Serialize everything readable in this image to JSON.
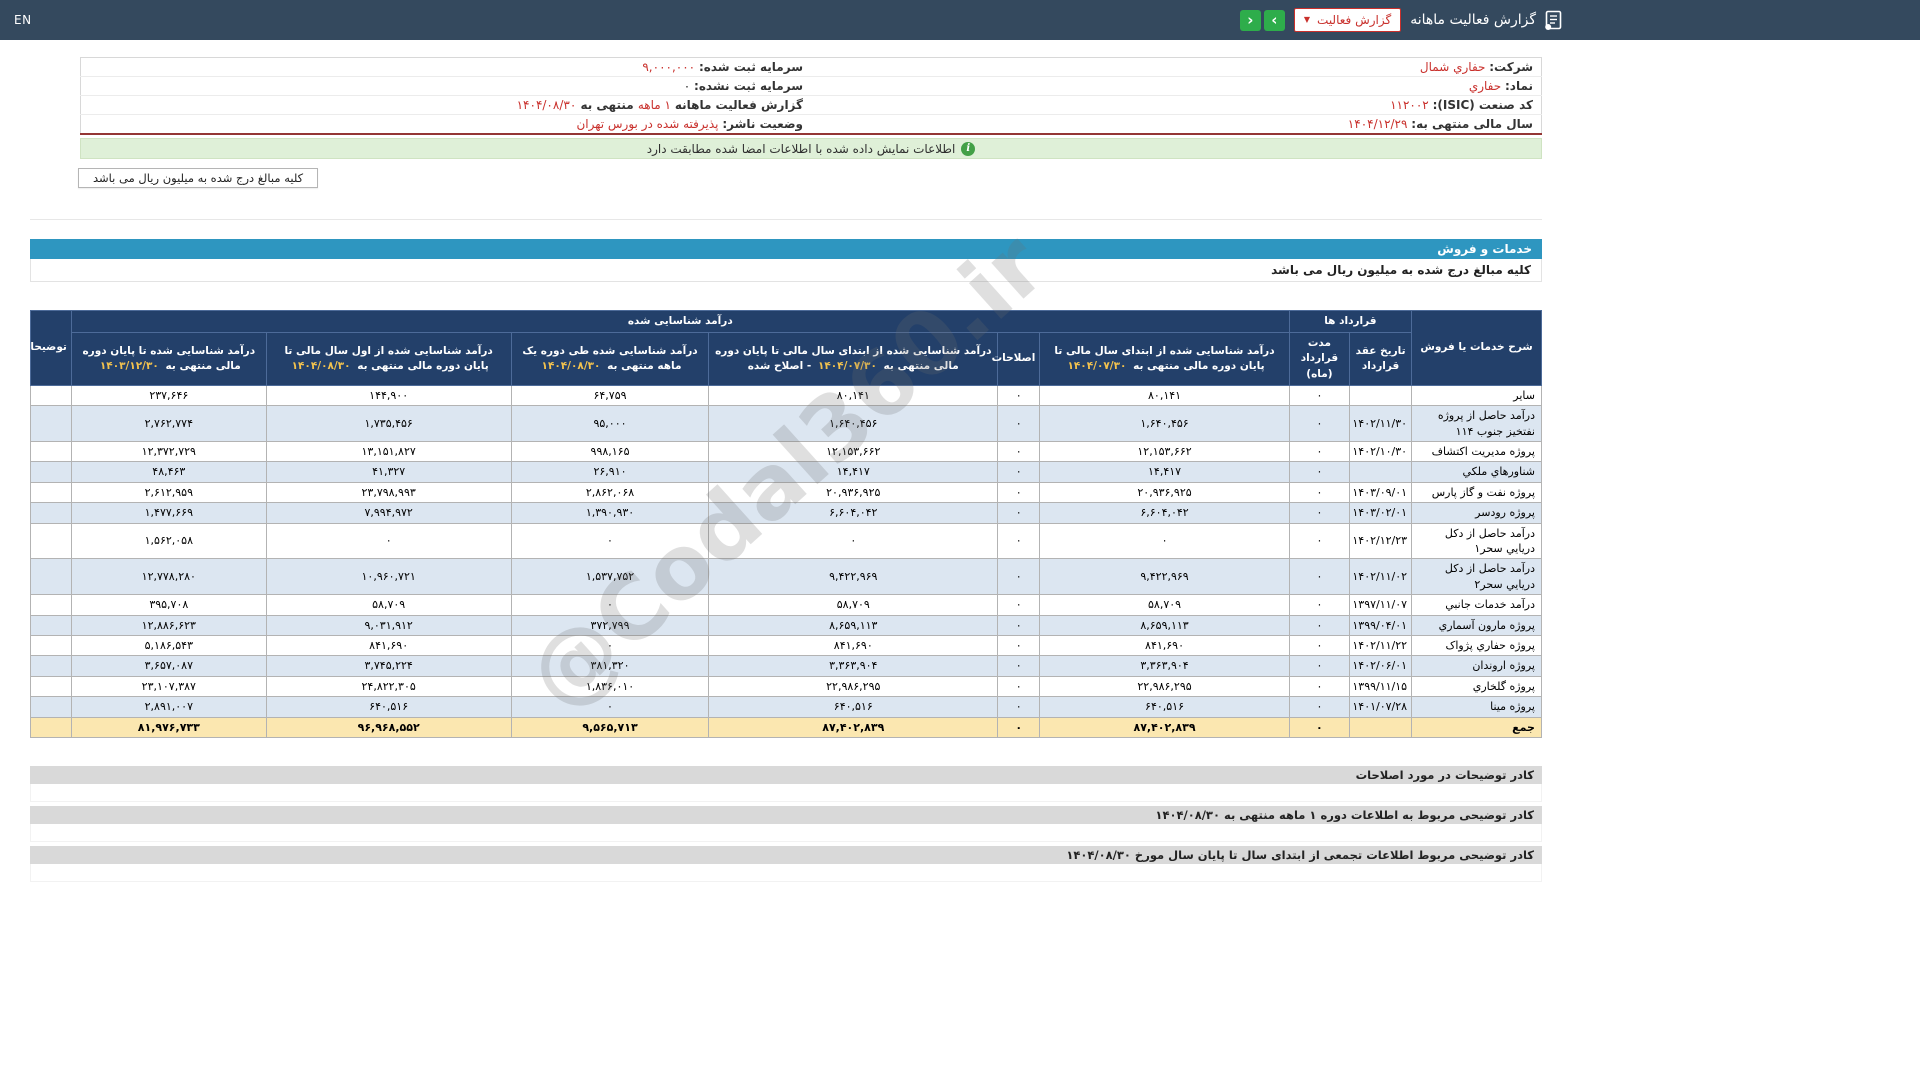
{
  "colors": {
    "topbar_bg": "#34495e",
    "accent_red": "#c9302c",
    "nav_green": "#2ead4b",
    "banner_green_bg": "#dff0d8",
    "rule_red": "#943634",
    "section_blue": "#2e96c0",
    "table_header_bg": "#23406a",
    "header_date_yellow": "#f2c24e",
    "row_stripe_blue": "#dce6f1",
    "total_row_bg": "#fbe7b0",
    "footer_gray": "#d9d9d9"
  },
  "topbar": {
    "title": "گزارش فعالیت ماهانه",
    "dropdown_label": "گزارش فعالیت",
    "dropdown_caret": "▼",
    "next_arrow": "›",
    "prev_arrow": "‹",
    "en_label": "EN"
  },
  "company_info": {
    "rows": [
      {
        "right": [
          {
            "t": "شرکت:",
            "k": "label"
          },
          {
            "t": " حفاري شمال",
            "k": "link"
          }
        ],
        "left": [
          {
            "t": "سرمایه ثبت شده:",
            "k": "label"
          },
          {
            "t": " ۹,۰۰۰,۰۰۰",
            "k": "red"
          }
        ]
      },
      {
        "right": [
          {
            "t": "نماد:",
            "k": "label"
          },
          {
            "t": " حفاري",
            "k": "red"
          }
        ],
        "left": [
          {
            "t": "سرمایه ثبت نشده:",
            "k": "label"
          },
          {
            "t": " ۰",
            "k": "plain"
          }
        ]
      },
      {
        "right": [
          {
            "t": "کد صنعت (ISIC):",
            "k": "label"
          },
          {
            "t": " ۱۱۲۰۰۲",
            "k": "red"
          }
        ],
        "left": [
          {
            "t": "گزارش فعالیت ماهانه",
            "k": "label"
          },
          {
            "t": " ۱ ماهه",
            "k": "red"
          },
          {
            "t": " منتهی به ",
            "k": "label"
          },
          {
            "t": "۱۴۰۴/۰۸/۳۰",
            "k": "red"
          }
        ]
      },
      {
        "right": [
          {
            "t": "سال مالی منتهی به:",
            "k": "label"
          },
          {
            "t": " ۱۴۰۴/۱۲/۲۹",
            "k": "red"
          }
        ],
        "left": [
          {
            "t": "وضعیت ناشر:",
            "k": "label"
          },
          {
            "t": " پذیرفته شده در بورس تهران",
            "k": "red"
          }
        ]
      }
    ]
  },
  "banners": {
    "signature_match": "اطلاعات نمایش داده شده با اطلاعات امضا شده مطابقت دارد",
    "million_note": "کلیه مبالغ درج شده به میلیون ریال می باشد"
  },
  "watermark": "@Codal360.ir",
  "sales_table": {
    "section_title": "خدمات و فروش",
    "note": "کلیه مبالغ درج شده به میلیون ریال می باشد",
    "header": {
      "desc": "شرح خدمات یا فروش",
      "contracts_group": "قرارداد ها",
      "revenue_group": "درآمد شناسایی شده",
      "notes": "توضیحات",
      "contract_date": "تاریخ عقد قرارداد",
      "contract_duration": "مدت قرارداد (ماه)",
      "col_prev_period": {
        "text": "درآمد شناسایی شده از ابتدای سال مالی تا پایان دوره مالی منتهی به",
        "date": "۱۴۰۴/۰۷/۳۰"
      },
      "col_corrections": "اصلاحات",
      "col_prev_corrected": {
        "text": "درآمد شناسایی شده از ابتدای سال مالی تا پایان دوره مالی منتهی به",
        "date": "۱۴۰۴/۰۷/۳۰",
        "suffix": "- اصلاح شده"
      },
      "col_month": {
        "text": "درآمد شناسایی شده طی دوره یک ماهه منتهی به",
        "date": "۱۴۰۴/۰۸/۳۰"
      },
      "col_ytd": {
        "text": "درآمد شناسایی شده از اول سال مالی تا پایان دوره مالی منتهی به",
        "date": "۱۴۰۴/۰۸/۳۰"
      },
      "col_prev_year": {
        "text": "درآمد شناسایی شده تا پایان دوره مالی منتهی به",
        "date": "۱۴۰۳/۱۲/۳۰"
      }
    },
    "rows": [
      [
        "سایر",
        "",
        "۰",
        "۸۰,۱۴۱",
        "۰",
        "۸۰,۱۴۱",
        "۶۴,۷۵۹",
        "۱۴۴,۹۰۰",
        "۲۳۷,۶۴۶",
        ""
      ],
      [
        "درآمد حاصل از پروژه نفتخیز جنوب ۱۱۴",
        "۱۴۰۲/۱۱/۳۰",
        "۰",
        "۱,۶۴۰,۴۵۶",
        "۰",
        "۱,۶۴۰,۴۵۶",
        "۹۵,۰۰۰",
        "۱,۷۳۵,۴۵۶",
        "۲,۷۶۲,۷۷۴",
        ""
      ],
      [
        "پروژه مدیریت اکتشاف",
        "۱۴۰۲/۱۰/۳۰",
        "۰",
        "۱۲,۱۵۳,۶۶۲",
        "۰",
        "۱۲,۱۵۳,۶۶۲",
        "۹۹۸,۱۶۵",
        "۱۳,۱۵۱,۸۲۷",
        "۱۲,۳۷۲,۷۲۹",
        ""
      ],
      [
        "شناورهاي ملكي",
        "",
        "۰",
        "۱۴,۴۱۷",
        "۰",
        "۱۴,۴۱۷",
        "۲۶,۹۱۰",
        "۴۱,۳۲۷",
        "۴۸,۴۶۳",
        ""
      ],
      [
        "پروژه نفت و گاز پارس",
        "۱۴۰۳/۰۹/۰۱",
        "۰",
        "۲۰,۹۳۶,۹۲۵",
        "۰",
        "۲۰,۹۳۶,۹۲۵",
        "۲,۸۶۲,۰۶۸",
        "۲۳,۷۹۸,۹۹۳",
        "۲,۶۱۲,۹۵۹",
        ""
      ],
      [
        "پروژه رودسر",
        "۱۴۰۳/۰۲/۰۱",
        "۰",
        "۶,۶۰۴,۰۴۲",
        "۰",
        "۶,۶۰۴,۰۴۲",
        "۱,۳۹۰,۹۳۰",
        "۷,۹۹۴,۹۷۲",
        "۱,۴۷۷,۶۶۹",
        ""
      ],
      [
        "درآمد حاصل از دكل دريايي سحر۱",
        "۱۴۰۲/۱۲/۲۳",
        "۰",
        "۰",
        "۰",
        "۰",
        "۰",
        "۰",
        "۱,۵۶۲,۰۵۸",
        ""
      ],
      [
        "درآمد حاصل از دكل دريايي سحر۲",
        "۱۴۰۲/۱۱/۰۲",
        "۰",
        "۹,۴۲۲,۹۶۹",
        "۰",
        "۹,۴۲۲,۹۶۹",
        "۱,۵۳۷,۷۵۲",
        "۱۰,۹۶۰,۷۲۱",
        "۱۲,۷۷۸,۲۸۰",
        ""
      ],
      [
        "درآمد خدمات جانبي",
        "۱۳۹۷/۱۱/۰۷",
        "۰",
        "۵۸,۷۰۹",
        "۰",
        "۵۸,۷۰۹",
        "۰",
        "۵۸,۷۰۹",
        "۳۹۵,۷۰۸",
        ""
      ],
      [
        "پروژه مارون آسماري",
        "۱۳۹۹/۰۴/۰۱",
        "۰",
        "۸,۶۵۹,۱۱۳",
        "۰",
        "۸,۶۵۹,۱۱۳",
        "۳۷۲,۷۹۹",
        "۹,۰۳۱,۹۱۲",
        "۱۲,۸۸۶,۶۲۳",
        ""
      ],
      [
        "پروژه حفاري پژواک",
        "۱۴۰۲/۱۱/۲۲",
        "۰",
        "۸۴۱,۶۹۰",
        "۰",
        "۸۴۱,۶۹۰",
        "۰",
        "۸۴۱,۶۹۰",
        "۵,۱۸۶,۵۴۳",
        ""
      ],
      [
        "پروژه اروندان",
        "۱۴۰۲/۰۶/۰۱",
        "۰",
        "۳,۳۶۳,۹۰۴",
        "۰",
        "۳,۳۶۳,۹۰۴",
        "۳۸۱,۳۲۰",
        "۳,۷۴۵,۲۲۴",
        "۳,۶۵۷,۰۸۷",
        ""
      ],
      [
        "پروژه گلخاري",
        "۱۳۹۹/۱۱/۱۵",
        "۰",
        "۲۲,۹۸۶,۲۹۵",
        "۰",
        "۲۲,۹۸۶,۲۹۵",
        "۱,۸۳۶,۰۱۰",
        "۲۴,۸۲۲,۳۰۵",
        "۲۳,۱۰۷,۳۸۷",
        ""
      ],
      [
        "پروژه مینا",
        "۱۴۰۱/۰۷/۲۸",
        "۰",
        "۶۴۰,۵۱۶",
        "۰",
        "۶۴۰,۵۱۶",
        "۰",
        "۶۴۰,۵۱۶",
        "۲,۸۹۱,۰۰۷",
        ""
      ]
    ],
    "total_row": [
      "جمع",
      "",
      "۰",
      "۸۷,۴۰۲,۸۳۹",
      "۰",
      "۸۷,۴۰۲,۸۳۹",
      "۹,۵۶۵,۷۱۳",
      "۹۶,۹۶۸,۵۵۲",
      "۸۱,۹۷۶,۷۳۳",
      ""
    ]
  },
  "footers": [
    "کادر توضیحات در مورد اصلاحات",
    "کادر توضیحی مربوط به اطلاعات دوره ۱ ماهه منتهی به ۱۴۰۴/۰۸/۳۰",
    "کادر توضیحی مربوط اطلاعات تجمعی از ابتدای سال تا پایان سال مورخ ۱۴۰۴/۰۸/۳۰"
  ]
}
